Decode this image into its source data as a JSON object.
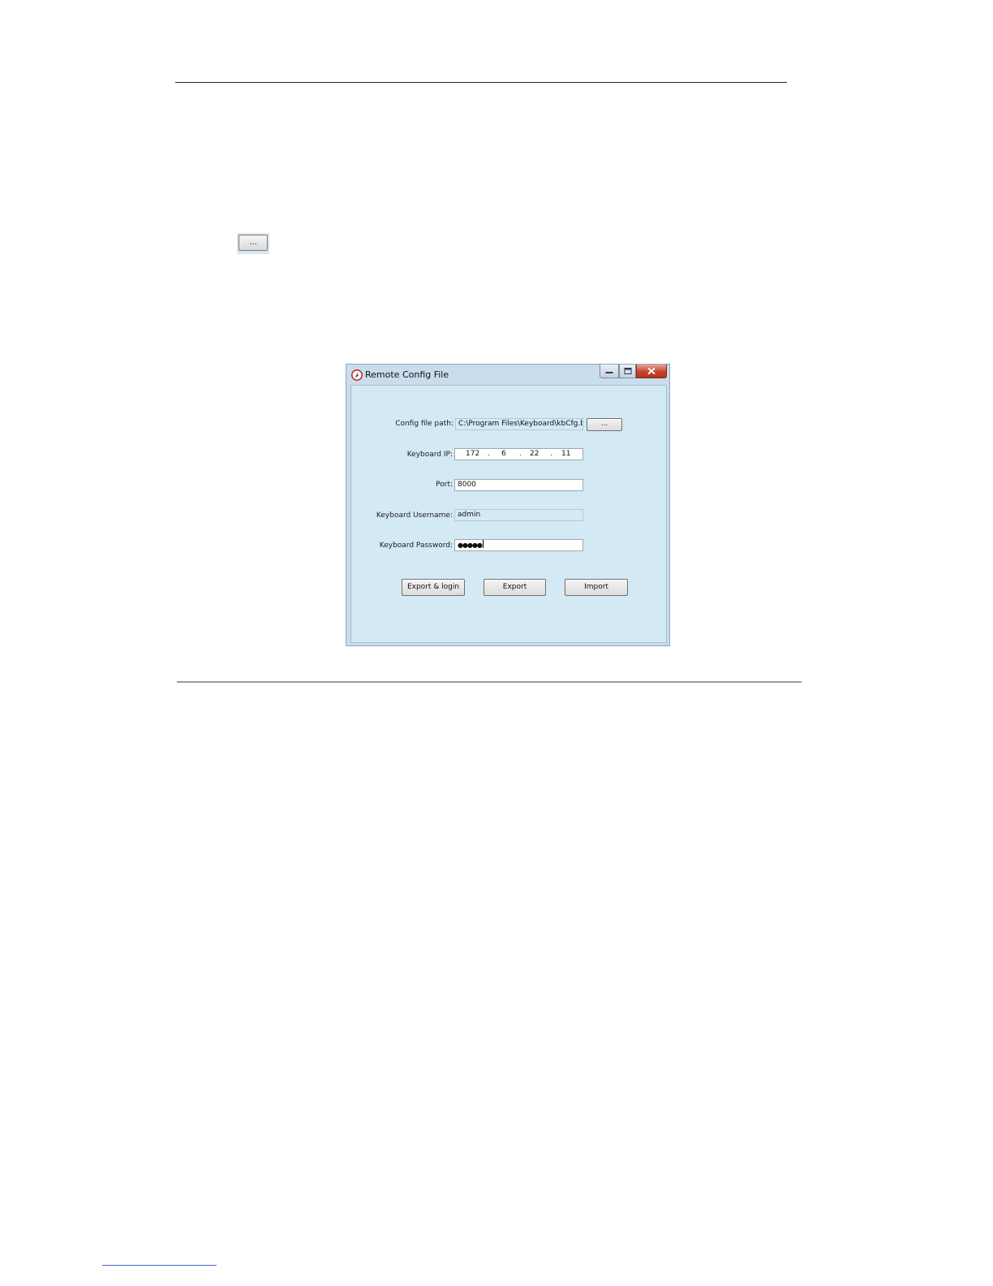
{
  "inline_button": {
    "label": "..."
  },
  "dialog": {
    "title": "Remote Config File",
    "fields": {
      "config_file_path": {
        "label": "Config file path:",
        "value": "C:\\Program Files\\Keyboard\\kbCfg.bin",
        "browse_label": "..."
      },
      "keyboard_ip": {
        "label": "Keyboard IP:",
        "octets": [
          "172",
          "6",
          "22",
          "11"
        ],
        "separator": "."
      },
      "port": {
        "label": "Port:",
        "value": "8000"
      },
      "keyboard_username": {
        "label": "Keyboard Username:",
        "value": "admin"
      },
      "keyboard_password": {
        "label": "Keyboard Password:",
        "value": "●●●●●"
      }
    },
    "buttons": {
      "export_login": "Export & login",
      "export": "Export",
      "import": "Import"
    }
  },
  "colors": {
    "window_frame": "#c9dded",
    "client_background": "#d3e9f4",
    "close_button": "#c8432b",
    "footnote_rule": "#4a67c8"
  }
}
